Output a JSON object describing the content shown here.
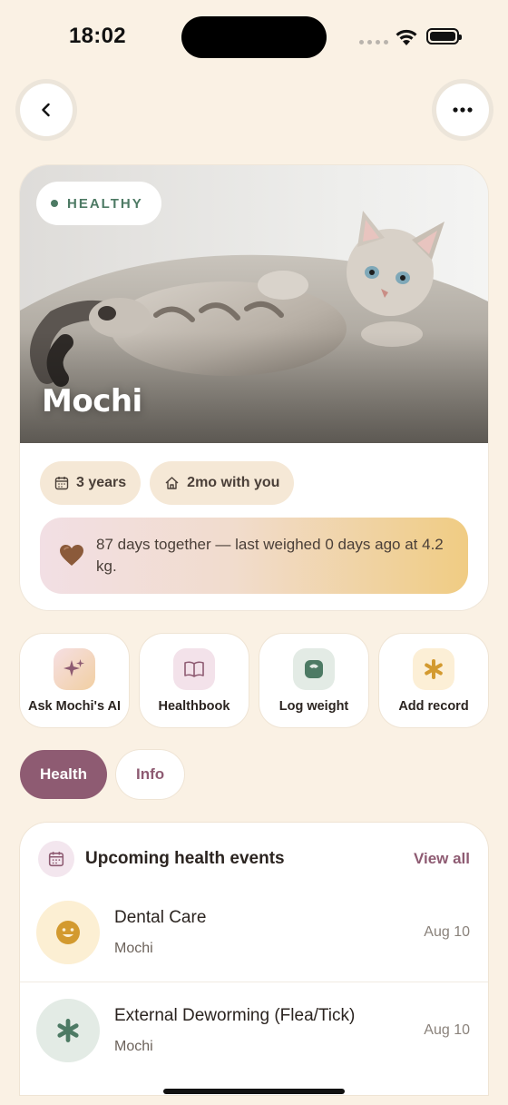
{
  "status_bar": {
    "time": "18:02"
  },
  "nav": {
    "back_icon": "chevron-left-icon",
    "more_icon": "ellipsis-icon"
  },
  "profile": {
    "status_badge": "HEALTHY",
    "status_color": "#4d7a64",
    "name": "Mochi",
    "chips": [
      {
        "icon": "calendar-icon",
        "label": "3 years"
      },
      {
        "icon": "home-icon",
        "label": "2mo with you"
      }
    ],
    "together_icon": "heart-icon",
    "together_text": "87 days together — last weighed 0 days ago at 4.2 kg."
  },
  "actions": [
    {
      "icon": "sparkles-icon",
      "label": "Ask Mochi's AI",
      "bg": "#f4d9cf"
    },
    {
      "icon": "book-icon",
      "label": "Healthbook",
      "bg": "#f3e2ea"
    },
    {
      "icon": "scale-icon",
      "label": "Log weight",
      "bg": "#e3ebe5"
    },
    {
      "icon": "asterisk-icon",
      "label": "Add record",
      "bg": "#fcefd6"
    }
  ],
  "tabs": [
    {
      "label": "Health",
      "active": true
    },
    {
      "label": "Info",
      "active": false
    }
  ],
  "events": {
    "title": "Upcoming health events",
    "view_all": "View all",
    "items": [
      {
        "icon": "smile-icon",
        "title": "Dental Care",
        "pet": "Mochi",
        "date": "Aug 10",
        "icon_bg": "#fcefd3"
      },
      {
        "icon": "asterisk-icon",
        "title": "External Deworming (Flea/Tick)",
        "pet": "Mochi",
        "date": "Aug 10",
        "icon_bg": "#e3ebe5"
      }
    ]
  },
  "colors": {
    "accent": "#8e5b72",
    "background": "#faf1e4",
    "healthy": "#4d7a64"
  }
}
